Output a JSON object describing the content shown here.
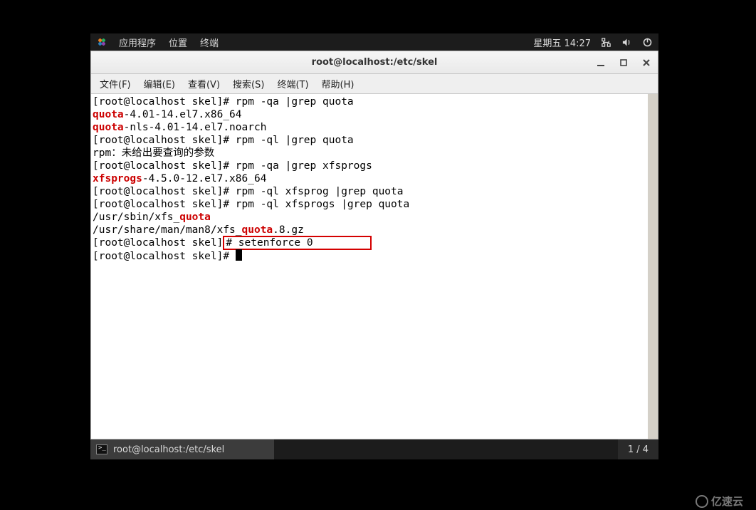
{
  "top_panel": {
    "menu": {
      "apps": "应用程序",
      "places": "位置",
      "terminal": "终端"
    },
    "clock": "星期五 14:27"
  },
  "window": {
    "title": "root@localhost:/etc/skel",
    "menu": {
      "file": "文件(F)",
      "edit": "编辑(E)",
      "view": "查看(V)",
      "search": "搜索(S)",
      "term": "终端(T)",
      "help": "帮助(H)"
    }
  },
  "terminal": {
    "lines": [
      {
        "prompt": "[root@localhost skel]# ",
        "cmd": "rpm -qa |grep quota"
      },
      {
        "hl": "quota",
        "rest": "-4.01-14.el7.x86_64"
      },
      {
        "hl": "quota",
        "rest": "-nls-4.01-14.el7.noarch"
      },
      {
        "prompt": "[root@localhost skel]# ",
        "cmd": "rpm -ql |grep quota"
      },
      {
        "plain": "rpm：未给出要查询的参数"
      },
      {
        "prompt": "[root@localhost skel]# ",
        "cmd": "rpm -qa |grep xfsprogs"
      },
      {
        "hl": "xfsprogs",
        "rest": "-4.5.0-12.el7.x86_64"
      },
      {
        "prompt": "[root@localhost skel]# ",
        "cmd": "rpm -ql xfsprog |grep quota"
      },
      {
        "prompt": "[root@localhost skel]# ",
        "cmd": "rpm -ql xfsprogs |grep quota"
      },
      {
        "pre": "/usr/sbin/xfs_",
        "hl": "quota"
      },
      {
        "pre": "/usr/share/man/man8/xfs_",
        "hl": "quota",
        "rest": ".8.gz"
      },
      {
        "prompt": "[root@localhost skel]",
        "boxed": "# setenforce 0         "
      },
      {
        "prompt": "[root@localhost skel]# ",
        "cursor": true
      }
    ]
  },
  "taskbar": {
    "app": "root@localhost:/etc/skel",
    "workspace": "1 / 4"
  },
  "watermark": "亿速云"
}
